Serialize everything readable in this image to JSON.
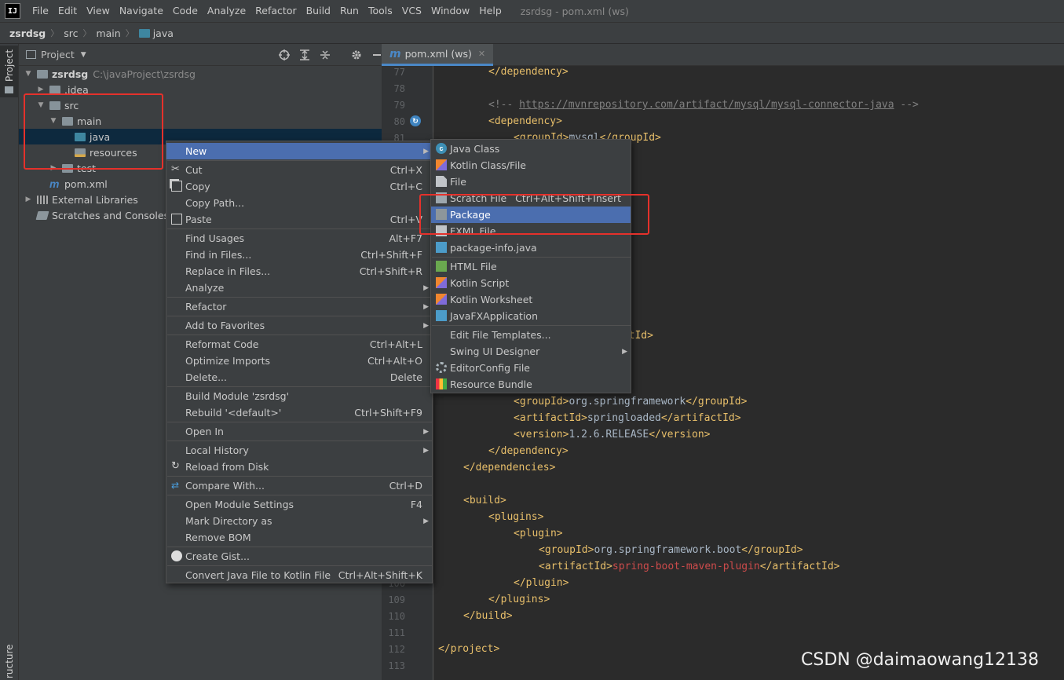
{
  "app": {
    "logo_text": "IJ",
    "window_title": "zsrdsg - pom.xml (ws)",
    "menus": [
      "File",
      "Edit",
      "View",
      "Navigate",
      "Code",
      "Analyze",
      "Refactor",
      "Build",
      "Run",
      "Tools",
      "VCS",
      "Window",
      "Help"
    ]
  },
  "breadcrumb": [
    "zsrdsg",
    "src",
    "main",
    "java"
  ],
  "left_strip": {
    "project_label": "Project",
    "structure_label": "ructure"
  },
  "project_panel": {
    "title": "Project",
    "tree": [
      {
        "label": "zsrdsg",
        "path": "C:\\javaProject\\zsrdsg",
        "icon": "module-folder-icon",
        "arrow": "down",
        "indent": 0
      },
      {
        "label": ".idea",
        "icon": "folder-icon",
        "arrow": "right",
        "indent": 1
      },
      {
        "label": "src",
        "icon": "folder-icon",
        "arrow": "down",
        "indent": 1
      },
      {
        "label": "main",
        "icon": "folder-icon",
        "arrow": "down",
        "indent": 2
      },
      {
        "label": "java",
        "icon": "source-folder-icon",
        "arrow": "",
        "indent": 3,
        "selected": true
      },
      {
        "label": "resources",
        "icon": "resources-folder-icon",
        "arrow": "",
        "indent": 3
      },
      {
        "label": "test",
        "icon": "folder-icon",
        "arrow": "right",
        "indent": 2
      },
      {
        "label": "pom.xml",
        "icon": "maven-icon",
        "arrow": "",
        "indent": 1
      },
      {
        "label": "External Libraries",
        "icon": "libraries-icon",
        "arrow": "right",
        "indent": 0
      },
      {
        "label": "Scratches and Consoles",
        "icon": "scratches-icon",
        "arrow": "",
        "indent": 0
      }
    ]
  },
  "editor": {
    "tab_label": "pom.xml (ws)",
    "line_numbers": [
      "77",
      "78",
      "79",
      "80",
      "81",
      "",
      "",
      "",
      "",
      "",
      "",
      "",
      "",
      "",
      "",
      "",
      "",
      "",
      "",
      "",
      "",
      "",
      "",
      "",
      "",
      "",
      "",
      "",
      "",
      "",
      "",
      "106",
      "109",
      "110",
      "111",
      "112",
      "113"
    ],
    "lines": [
      [
        {
          "t": "</dependency>",
          "k": "tag"
        }
      ],
      [],
      [
        {
          "t": "<!-- ",
          "k": "comment"
        },
        {
          "t": "https://mvnrepository.com/artifact/mysql/mysql-connector-java",
          "k": "url"
        },
        {
          "t": " -->",
          "k": "comment"
        }
      ],
      [
        {
          "t": "<dependency>",
          "k": "tag"
        }
      ],
      [
        {
          "t": "<groupId>",
          "k": "tag"
        },
        {
          "t": "mysql",
          "k": "text"
        },
        {
          "t": "</groupId>",
          "k": "tag"
        }
      ],
      [
        {
          "t": "connector-java",
          "k": "text"
        },
        {
          "t": "</artifactId>",
          "k": "tag"
        }
      ],
      [],
      [],
      [],
      [
        {
          "t": "a",
          "k": "text"
        },
        {
          "t": "</groupId>",
          "k": "tag"
        }
      ],
      [
        {
          "t": "artifactId>",
          "k": "tag"
        }
      ],
      [
        {
          "t": "rsion}",
          "k": "text"
        },
        {
          "t": "</version>",
          "k": "tag"
        }
      ],
      [],
      [],
      [],
      [
        {
          "t": "framework.boot",
          "k": "text"
        },
        {
          "t": "</groupId>",
          "k": "tag"
        }
      ],
      [
        {
          "t": "boot-starter-thymeleaf",
          "k": "text"
        },
        {
          "t": "</artifactId>",
          "k": "tag"
        }
      ],
      [],
      [],
      [],
      [
        {
          "t": "<groupId>",
          "k": "tag"
        },
        {
          "t": "org.springframework",
          "k": "text"
        },
        {
          "t": "</groupId>",
          "k": "tag"
        }
      ],
      [
        {
          "t": "<artifactId>",
          "k": "tag"
        },
        {
          "t": "springloaded",
          "k": "text"
        },
        {
          "t": "</artifactId>",
          "k": "tag"
        }
      ],
      [
        {
          "t": "<version>",
          "k": "tag"
        },
        {
          "t": "1.2.6.RELEASE",
          "k": "text"
        },
        {
          "t": "</version>",
          "k": "tag"
        }
      ],
      [
        {
          "t": "</dependency>",
          "k": "tag"
        }
      ],
      [
        {
          "t": "</dependencies>",
          "k": "tag"
        }
      ],
      [],
      [
        {
          "t": "<build>",
          "k": "tag"
        }
      ],
      [
        {
          "t": "<plugins>",
          "k": "tag"
        }
      ],
      [
        {
          "t": "<plugin>",
          "k": "tag"
        }
      ],
      [
        {
          "t": "<groupId>",
          "k": "tag"
        },
        {
          "t": "org.springframework.boot",
          "k": "text"
        },
        {
          "t": "</groupId>",
          "k": "tag"
        }
      ],
      [
        {
          "t": "<artifactId>",
          "k": "tag"
        },
        {
          "t": "spring-boot-maven-plugin",
          "k": "red"
        },
        {
          "t": "</artifactId>",
          "k": "tag"
        }
      ],
      [
        {
          "t": "</plugin>",
          "k": "tag"
        }
      ],
      [
        {
          "t": "</plugins>",
          "k": "tag"
        }
      ],
      [
        {
          "t": "</build>",
          "k": "tag"
        }
      ],
      [],
      [
        {
          "t": "</project>",
          "k": "tag"
        }
      ],
      []
    ],
    "indents": [
      2,
      0,
      2,
      2,
      3,
      0,
      0,
      0,
      0,
      0,
      0,
      0,
      0,
      0,
      0,
      0,
      0,
      0,
      0,
      0,
      3,
      3,
      3,
      2,
      1,
      0,
      1,
      2,
      3,
      4,
      4,
      3,
      2,
      1,
      0,
      0,
      0
    ]
  },
  "context_menu": {
    "items": [
      {
        "label": "New",
        "shortcut": "",
        "sub": true,
        "icon": "",
        "hl": true
      },
      {
        "sep": true
      },
      {
        "label": "Cut",
        "shortcut": "Ctrl+X",
        "icon": "scissors-icon"
      },
      {
        "label": "Copy",
        "shortcut": "Ctrl+C",
        "icon": "copy-icon"
      },
      {
        "label": "Copy Path...",
        "shortcut": "",
        "icon": ""
      },
      {
        "label": "Paste",
        "shortcut": "Ctrl+V",
        "icon": "paste-icon"
      },
      {
        "sep": true
      },
      {
        "label": "Find Usages",
        "shortcut": "Alt+F7",
        "icon": ""
      },
      {
        "label": "Find in Files...",
        "shortcut": "Ctrl+Shift+F",
        "icon": ""
      },
      {
        "label": "Replace in Files...",
        "shortcut": "Ctrl+Shift+R",
        "icon": ""
      },
      {
        "label": "Analyze",
        "shortcut": "",
        "sub": true,
        "icon": ""
      },
      {
        "sep": true
      },
      {
        "label": "Refactor",
        "shortcut": "",
        "sub": true,
        "icon": ""
      },
      {
        "sep": true
      },
      {
        "label": "Add to Favorites",
        "shortcut": "",
        "sub": true,
        "icon": ""
      },
      {
        "sep": true
      },
      {
        "label": "Reformat Code",
        "shortcut": "Ctrl+Alt+L",
        "icon": ""
      },
      {
        "label": "Optimize Imports",
        "shortcut": "Ctrl+Alt+O",
        "icon": ""
      },
      {
        "label": "Delete...",
        "shortcut": "Delete",
        "icon": ""
      },
      {
        "sep": true
      },
      {
        "label": "Build Module 'zsrdsg'",
        "shortcut": "",
        "icon": ""
      },
      {
        "label": "Rebuild '<default>'",
        "shortcut": "Ctrl+Shift+F9",
        "icon": ""
      },
      {
        "sep": true
      },
      {
        "label": "Open In",
        "shortcut": "",
        "sub": true,
        "icon": ""
      },
      {
        "sep": true
      },
      {
        "label": "Local History",
        "shortcut": "",
        "sub": true,
        "icon": ""
      },
      {
        "label": "Reload from Disk",
        "shortcut": "",
        "icon": "reload-icon"
      },
      {
        "sep": true
      },
      {
        "label": "Compare With...",
        "shortcut": "Ctrl+D",
        "icon": "compare-icon"
      },
      {
        "sep": true
      },
      {
        "label": "Open Module Settings",
        "shortcut": "F4",
        "icon": ""
      },
      {
        "label": "Mark Directory as",
        "shortcut": "",
        "sub": true,
        "icon": ""
      },
      {
        "label": "Remove BOM",
        "shortcut": "",
        "icon": ""
      },
      {
        "sep": true
      },
      {
        "label": "Create Gist...",
        "shortcut": "",
        "icon": "github-icon"
      },
      {
        "sep": true
      },
      {
        "label": "Convert Java File to Kotlin File",
        "shortcut": "Ctrl+Alt+Shift+K",
        "icon": ""
      }
    ]
  },
  "new_submenu": {
    "items": [
      {
        "label": "Java Class",
        "shortcut": "",
        "icon": "java-class-icon"
      },
      {
        "label": "Kotlin Class/File",
        "shortcut": "",
        "icon": "kotlin-file-icon"
      },
      {
        "label": "File",
        "shortcut": "",
        "icon": "file-icon"
      },
      {
        "label": "Scratch File",
        "shortcut": "Ctrl+Alt+Shift+Insert",
        "icon": "scratch-file-icon"
      },
      {
        "label": "Package",
        "shortcut": "",
        "icon": "package-icon",
        "hl": true
      },
      {
        "label": "FXML File",
        "shortcut": "",
        "icon": "fxml-file-icon"
      },
      {
        "label": "package-info.java",
        "shortcut": "",
        "icon": "package-info-icon"
      },
      {
        "sep": true
      },
      {
        "label": "HTML File",
        "shortcut": "",
        "icon": "html-file-icon"
      },
      {
        "label": "Kotlin Script",
        "shortcut": "",
        "icon": "kotlin-script-icon"
      },
      {
        "label": "Kotlin Worksheet",
        "shortcut": "",
        "icon": "kotlin-worksheet-icon"
      },
      {
        "label": "JavaFXApplication",
        "shortcut": "",
        "icon": "javafx-icon"
      },
      {
        "sep": true
      },
      {
        "label": "Edit File Templates...",
        "shortcut": "",
        "icon": ""
      },
      {
        "label": "Swing UI Designer",
        "shortcut": "",
        "sub": true,
        "icon": ""
      },
      {
        "label": "EditorConfig File",
        "shortcut": "",
        "icon": "gear-icon"
      },
      {
        "label": "Resource Bundle",
        "shortcut": "",
        "icon": "resource-bundle-icon"
      }
    ]
  },
  "colors": {
    "accent": "#4b6eaf",
    "annotation": "#e5312b",
    "selection": "#0d293e"
  },
  "watermark": "CSDN @daimaowang12138"
}
